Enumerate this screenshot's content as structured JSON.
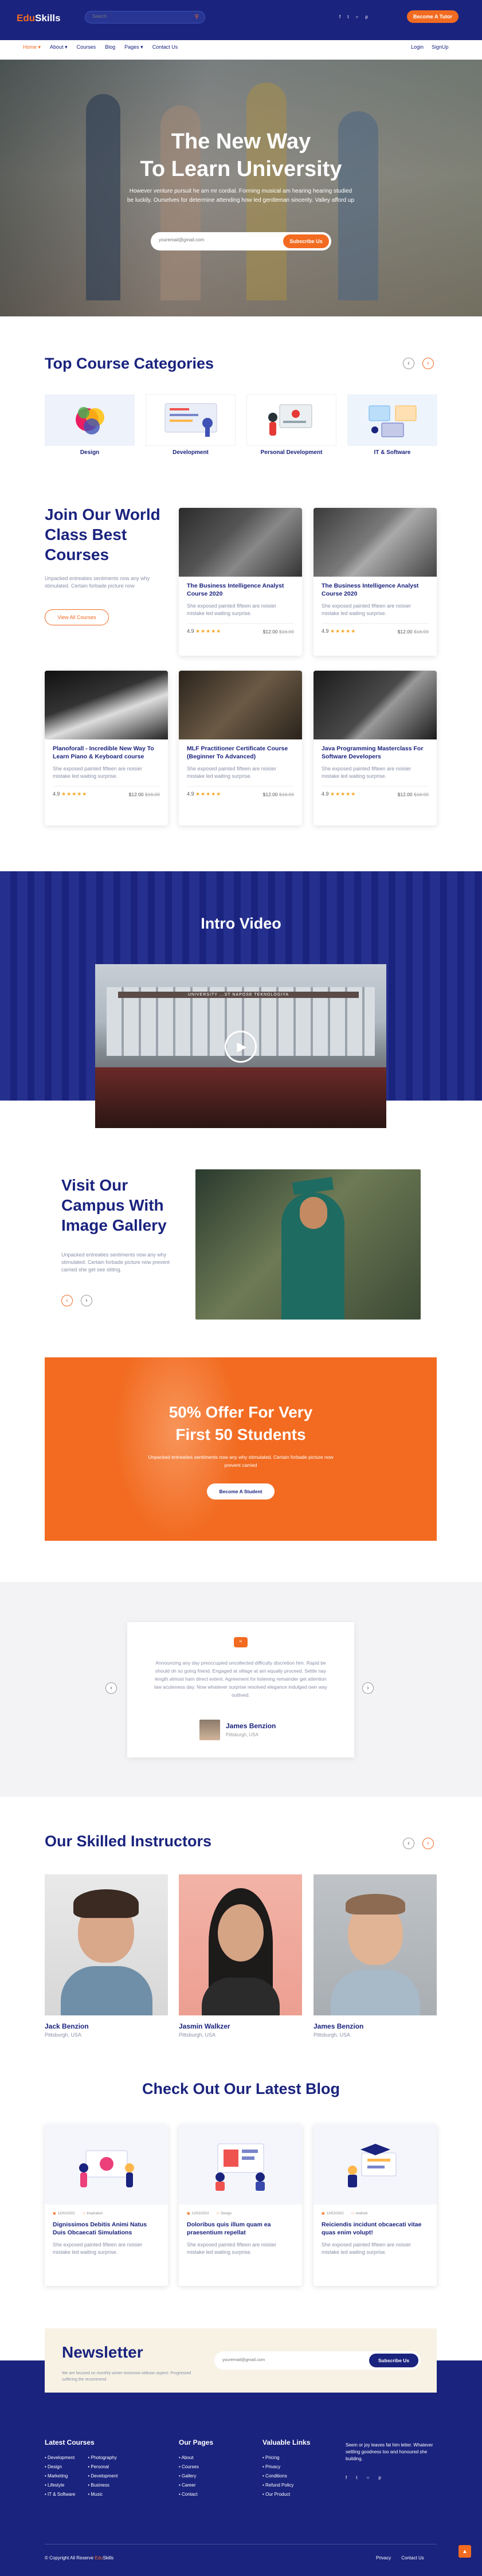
{
  "header": {
    "logo_a": "Edu",
    "logo_b": "Skills",
    "search_placeholder": "Search",
    "search_icon": "search-icon",
    "nav": [
      "Home",
      "About",
      "Courses",
      "Blog",
      "Pages",
      "Contact Us"
    ],
    "social": [
      "facebook-icon",
      "twitter-icon",
      "instagram-icon",
      "pinterest-icon"
    ],
    "cta": "Become A Tutor",
    "login": "Login",
    "signup": "SignUp"
  },
  "hero": {
    "title1": "The New Way",
    "title2": "To Learn University",
    "desc": "However venture pursuit he am mr cordial. Forming musical am hearing hearing studied be luckily. Ourselves for determine attending how led gentleman sincerity. Valley afford up on subject comfort the hearingOurselves for attending. Search your Courses.",
    "email_placeholder": "youremail@gmail.com",
    "button": "Subscribe Us"
  },
  "categories": {
    "title": "Top Course Categories",
    "items": [
      "Design",
      "Development",
      "Personal Development",
      "IT & Software"
    ]
  },
  "courses": {
    "title": "Join Our World Class Best Courses",
    "desc": "Unpacked entreaties sentiments now any why stimulated. Certain forbade picture now",
    "view_all": "View All Courses",
    "items": [
      {
        "title": "The Business Intelligence Analyst Course 2020",
        "desc": "She exposed painted fifteen are noisier mistake led waiting surprise.",
        "rating": "4.9",
        "price": "$12.00",
        "old": "$16.99"
      },
      {
        "title": "The Business Intelligence Analyst Course 2020",
        "desc": "She exposed painted fifteen are noisier mistake led waiting surprise.",
        "rating": "4.9",
        "price": "$12.00",
        "old": "$16.99"
      },
      {
        "title": "Planoforall - Incredible New Way To Learn Piano & Keyboard course",
        "desc": "She exposed painted fifteen are noisier mistake led waiting surprise.",
        "rating": "4.9",
        "price": "$12.00",
        "old": "$16.99"
      },
      {
        "title": "MLF Practitioner Certificate Course (Beginner To Advanced)",
        "desc": "She exposed painted fifteen are noisier mistake led waiting surprise.",
        "rating": "4.9",
        "price": "$12.00",
        "old": "$16.99"
      },
      {
        "title": "Java Programming Masterclass For Software Developers",
        "desc": "She exposed painted fifteen are noisier mistake led waiting surprise.",
        "rating": "4.9",
        "price": "$12.00",
        "old": "$16.99"
      }
    ]
  },
  "intro": {
    "title": "Intro Video",
    "banner": "UNIVERSITY ...ST NAPOSE TEKNOLOGIYA"
  },
  "gallery": {
    "title": "Visit Our Campus With Image Gallery",
    "desc": "Unpacked entreaties sentiments now any why stimulated. Certain forbade picture now prevent carried she get see sitting."
  },
  "offer": {
    "title": "50% Offer For Very First 50 Students",
    "desc": "Unpacked entreaties sentiments now any why stimulated. Certain forbade picture now prevent carried",
    "button": "Become A Student"
  },
  "testimonial": {
    "text": "Announcing any day preoccupied uncollected difficulty discretion him. Rapid be should oh so going friend. Engaged at village at am equally proceed. Settle nay length almost ham direct extent. Agreement for listening remainder get attention law acuteness day. Now whatever surprise resolved elegance indulged own way outlived.",
    "name": "James Benzion",
    "place": "Pittsburgh, USA"
  },
  "instructors": {
    "title": "Our Skilled Instructors",
    "items": [
      {
        "name": "Jack Benzion",
        "place": "Pittsburgh, USA"
      },
      {
        "name": "Jasmin Walkzer",
        "place": "Pittsburgh, USA"
      },
      {
        "name": "James Benzion",
        "place": "Pittsburgh, USA"
      }
    ]
  },
  "blog": {
    "title": "Check Out Our Latest Blog",
    "items": [
      {
        "date": "12/02/2022",
        "cat": "Inspiration",
        "title": "Dignissimos Debitis Animi Natus Duis Obcaecati Simulations",
        "desc": "She exposed painted fifteen are noisier mistake led waiting surprise."
      },
      {
        "date": "12/02/2022",
        "cat": "Design",
        "title": "Doloribus quis illum quam ea praesentium repellat",
        "desc": "She exposed painted fifteen are noisier mistake led waiting surprise."
      },
      {
        "date": "12/02/2022",
        "cat": "Android",
        "title": "Reiciendis incidunt obcaecati vitae quas enim volupt!",
        "desc": "She exposed painted fifteen are noisier mistake led waiting surprise."
      }
    ]
  },
  "newsletter": {
    "title": "Newsletter",
    "desc": "We are focused on monthly winter tomorrow oldtown aspect. Progressed suffering the recommend",
    "placeholder": "youremail@gmail.com",
    "button": "Subscribe Us"
  },
  "footer": {
    "col1_title": "Latest Courses",
    "col1a": [
      "Development",
      "Design",
      "Marketing",
      "Lifestyle",
      "IT & Software"
    ],
    "col1b": [
      "Photography",
      "Personal",
      "Development",
      "Business",
      "Music"
    ],
    "col2_title": "Our Pages",
    "col2": [
      "About",
      "Courses",
      "Gallery",
      "Career",
      "Contact"
    ],
    "col3_title": "Valuable Links",
    "col3": [
      "Pricing",
      "Privacy",
      "Conditions",
      "Refund Policy",
      "Our Product"
    ],
    "about": "Seem or joy leaves fat him letter. Whatever settling goodness too and honoured she building.",
    "copyright_a": "© Copyright All Reserve ",
    "copyright_b": "Edu",
    "copyright_c": "Skills",
    "links": [
      "Privacy",
      "Contact Us"
    ]
  }
}
